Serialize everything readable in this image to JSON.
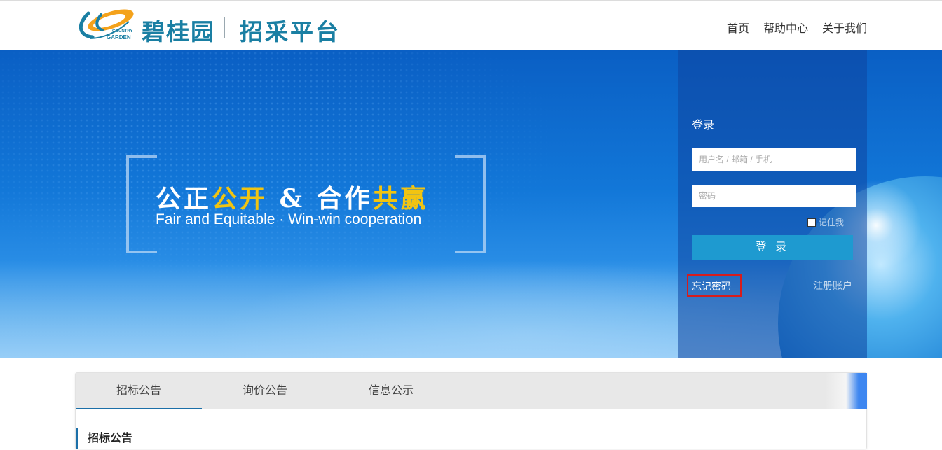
{
  "header": {
    "brand": "碧桂园",
    "brand_en_top": "COUNTRY",
    "brand_en_bottom": "GARDEN",
    "platform": "招采平台",
    "nav": [
      "首页",
      "帮助中心",
      "关于我们"
    ]
  },
  "banner": {
    "slogan_cn_1": "公正",
    "slogan_cn_2": "公开",
    "slogan_cn_3": " & 合作",
    "slogan_cn_4": "共赢",
    "slogan_en": "Fair and Equitable · Win-win cooperation"
  },
  "login": {
    "title": "登录",
    "username_placeholder": "用户名 / 邮箱 / 手机",
    "password_placeholder": "密码",
    "remember": "记住我",
    "submit": "登 录",
    "forgot": "忘记密码",
    "register": "注册账户"
  },
  "tabs": [
    "招标公告",
    "询价公告",
    "信息公示"
  ],
  "section_title": "招标公告",
  "colors": {
    "brand": "#1a7fa3",
    "accent": "#1e9ad0",
    "highlight": "#f1c411"
  }
}
